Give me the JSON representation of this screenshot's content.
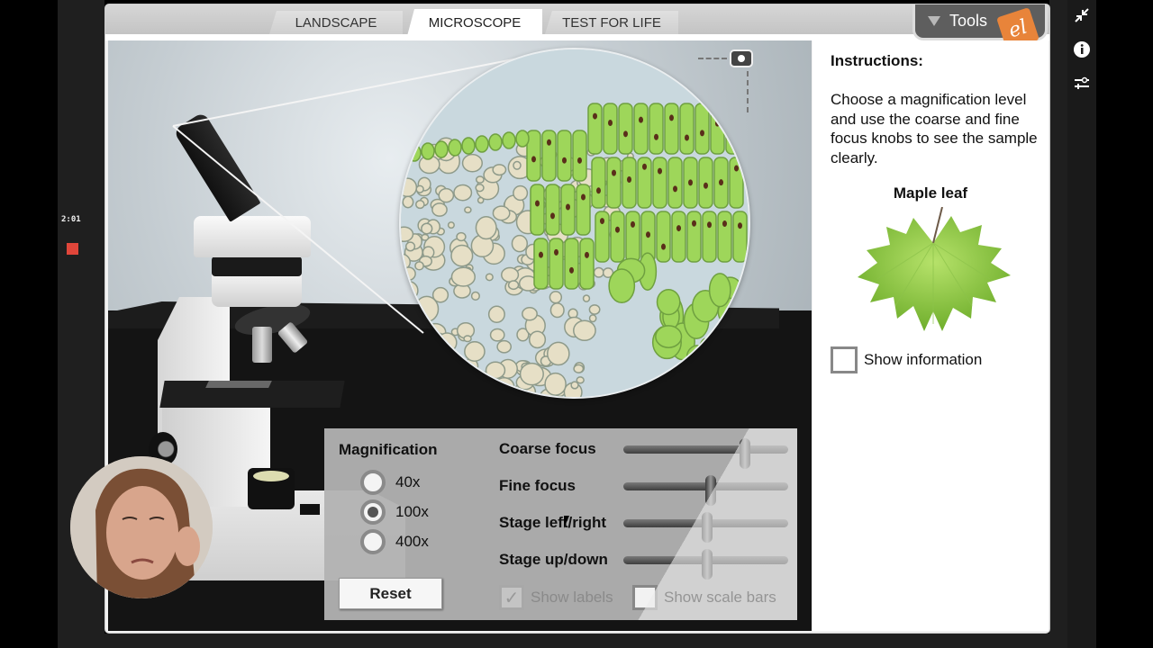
{
  "recorder": {
    "timer": "2:01",
    "record_color": "#e0463a"
  },
  "side_toolbar": {
    "items": [
      {
        "icon": "collapse-arrows-icon",
        "glyph": "⤡"
      },
      {
        "icon": "info-icon",
        "glyph": "i"
      },
      {
        "icon": "sliders-icon",
        "glyph": "⚙"
      }
    ]
  },
  "tabs": [
    {
      "label": "LANDSCAPE",
      "active": false
    },
    {
      "label": "MICROSCOPE",
      "active": true
    },
    {
      "label": "TEST FOR LIFE",
      "active": false
    }
  ],
  "tools": {
    "label": "Tools",
    "logo_text": "el",
    "logo_color": "#e8843a"
  },
  "controls": {
    "magnification": {
      "title": "Magnification",
      "options": [
        {
          "label": "40x",
          "selected": false
        },
        {
          "label": "100x",
          "selected": true
        },
        {
          "label": "400x",
          "selected": false
        }
      ]
    },
    "reset_label": "Reset",
    "sliders": [
      {
        "label": "Coarse focus",
        "value": 0.74
      },
      {
        "label": "Fine focus",
        "value": 0.53
      },
      {
        "label": "Stage left/right",
        "value": 0.51
      },
      {
        "label": "Stage up/down",
        "value": 0.51
      }
    ],
    "show_labels": {
      "label": "Show labels",
      "checked": true,
      "disabled": true
    },
    "show_scale_bars": {
      "label": "Show scale bars",
      "checked": false,
      "disabled": false
    }
  },
  "info_panel": {
    "title": "Instructions:",
    "text": "Choose a magnification level and use the coarse and fine focus knobs to see the sample clearly.",
    "sample_title": "Maple leaf",
    "show_information": {
      "label": "Show information",
      "checked": false
    }
  },
  "colors": {
    "leaf_green": "#8cc63f",
    "cell_green": "#9ed65a",
    "cell_nucleus": "#5a2e1a",
    "cell_tan": "#e6dfc6"
  }
}
